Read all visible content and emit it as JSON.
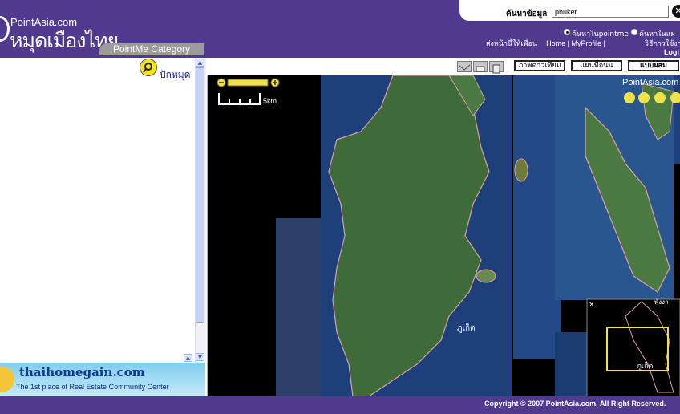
{
  "header": {
    "logo_small": "PointAsia.com",
    "logo_big": "หมุดเมืองไทย",
    "category_tab": "PointMe Category"
  },
  "search": {
    "label": "ค้นหาข้อมูล",
    "value": "phuket",
    "go_icon": "close-circle-icon",
    "option_pointme": "ค้นหาในpointme",
    "option_map": "ค้นหาในแผ"
  },
  "nav": {
    "send_friend": "ส่งหน้านี้ให้เพื่อน",
    "home": "Home",
    "sep1": "|",
    "profile": "MyProfile",
    "sep2": "|",
    "hidden_link": "",
    "help": "วิธีการใช้งา",
    "login": "Logi"
  },
  "left_panel": {
    "pin_link": "ปักหมุด",
    "pin_icon": "map-pin-icon"
  },
  "banner": {
    "title": "thaihomegain.com",
    "subtitle": "The 1st place of Real Estate Community Center"
  },
  "map_toolbar": {
    "icons": [
      "mail-icon",
      "print-icon",
      "document-icon"
    ],
    "view_satellite": "ภาพดาวเทียม",
    "view_map": "แผนที่ถนน",
    "view_hybrid": "แบบผสม"
  },
  "map": {
    "watermark": "PointAsia.com",
    "scale": "5km",
    "place_label": "ภูเก็ต",
    "overview_label": "ภูเก็ต",
    "overview_top_label": "พังงา"
  },
  "footer": {
    "copyright": "Copyright © 2007 PointAsia.com. All Right Reserved."
  },
  "colors": {
    "header_bg": "#4f3a8e",
    "link_blue": "#1f2a9a"
  }
}
